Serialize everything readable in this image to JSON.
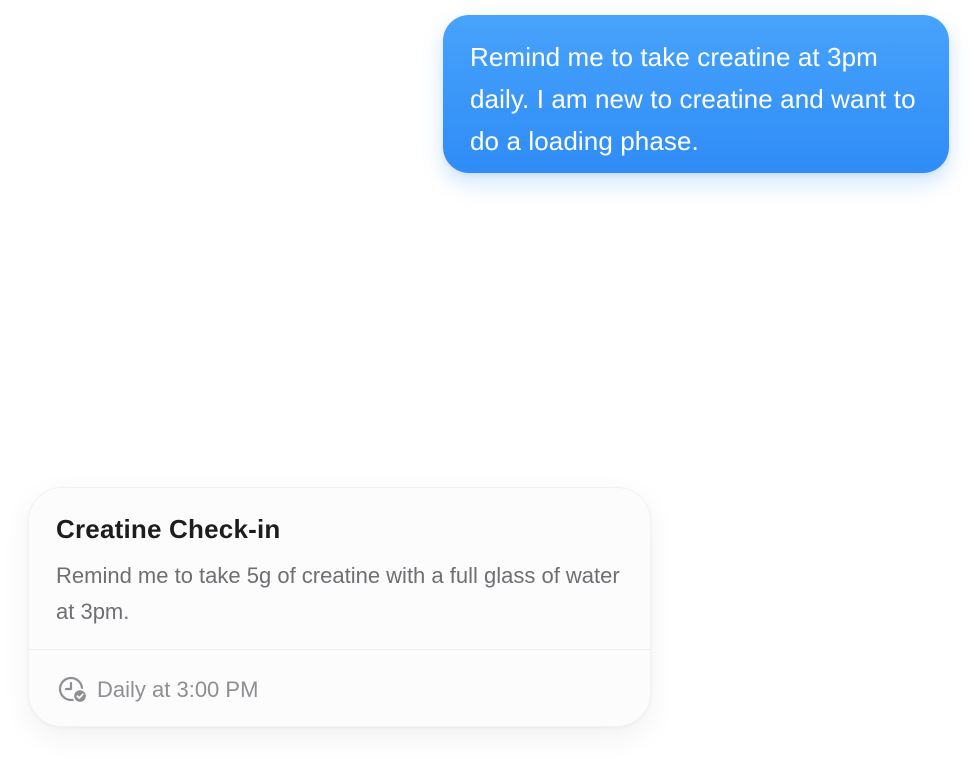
{
  "user_message": {
    "text": "Remind me to take creatine at 3pm daily. I am new to creatine and want to do a loading phase."
  },
  "reminder_card": {
    "title": "Creatine Check-in",
    "description": "Remind me to take 5g of creatine with a full glass of water at 3pm.",
    "schedule_icon": "clock-check-icon",
    "schedule": "Daily at 3:00 PM"
  },
  "colors": {
    "bubble_top": "#47a3fb",
    "bubble_bottom": "#2f8cf7",
    "card_background": "#fdfcfd",
    "title": "#1d1d1f",
    "body_text": "#6e6e73",
    "meta_text": "#8e8e93"
  }
}
